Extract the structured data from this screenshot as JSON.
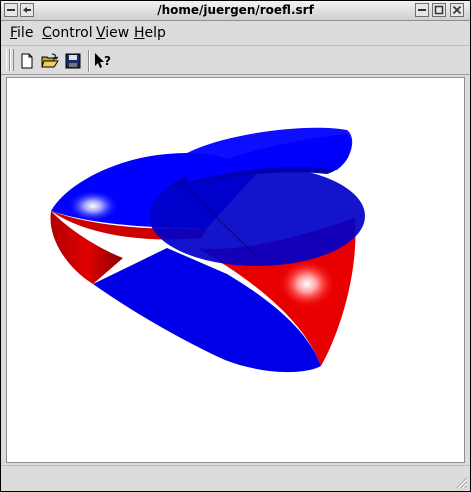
{
  "window": {
    "title": "/home/juergen/roefl.srf",
    "controls": {
      "menu_icon": "window-menu-icon",
      "minimize_icon": "minimize-icon",
      "maximize_icon": "maximize-icon",
      "close_icon": "close-icon"
    }
  },
  "menubar": {
    "items": [
      {
        "label": "File",
        "underline": "F"
      },
      {
        "label": "Control",
        "underline": "C"
      },
      {
        "label": "View",
        "underline": "V"
      },
      {
        "label": "Help",
        "underline": "H"
      }
    ]
  },
  "toolbar": {
    "tools": [
      {
        "name": "new-file-icon"
      },
      {
        "name": "open-folder-icon"
      },
      {
        "name": "save-disk-icon"
      },
      {
        "name": "whats-this-help-icon"
      }
    ]
  },
  "viewport": {
    "content": "3D rendered surface",
    "colors": {
      "front": "#0000ff",
      "back": "#ff0000",
      "background": "#ffffff"
    }
  },
  "statusbar": {
    "text": ""
  }
}
